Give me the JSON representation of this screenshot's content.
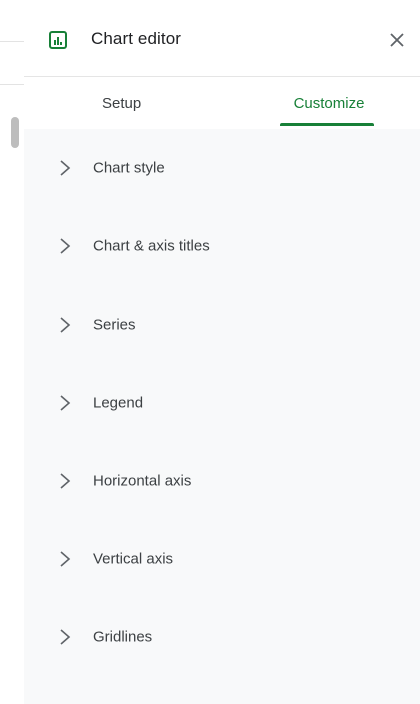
{
  "header": {
    "title": "Chart editor",
    "close_label": "close"
  },
  "tabs": [
    {
      "label": "Setup",
      "active": false
    },
    {
      "label": "Customize",
      "active": true
    }
  ],
  "sections": [
    {
      "label": "Chart style"
    },
    {
      "label": "Chart & axis titles"
    },
    {
      "label": "Series"
    },
    {
      "label": "Legend"
    },
    {
      "label": "Horizontal axis"
    },
    {
      "label": "Vertical axis"
    },
    {
      "label": "Gridlines"
    }
  ],
  "colors": {
    "accent": "#188038",
    "panel_bg": "#f8f9fa",
    "text": "#3c4043"
  }
}
